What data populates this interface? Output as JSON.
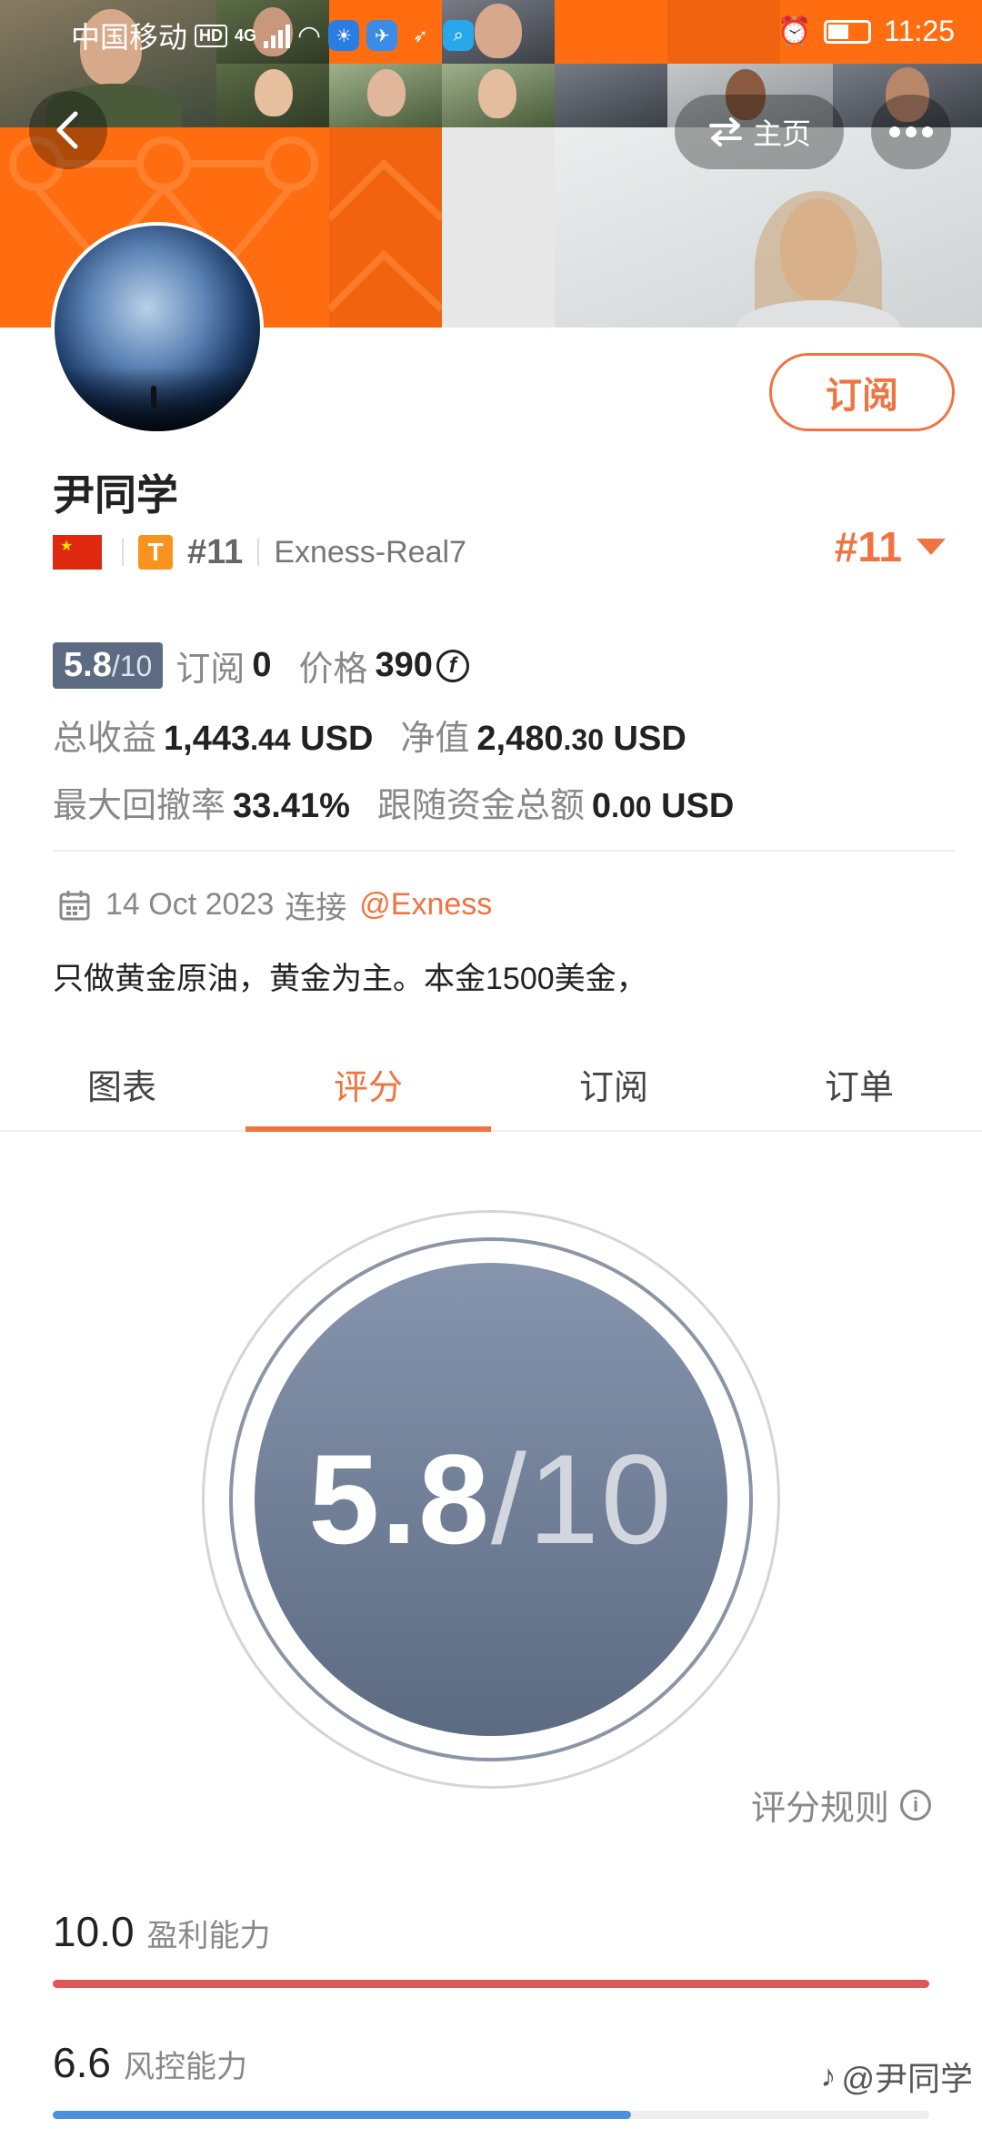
{
  "status_bar": {
    "carrier": "中国移动",
    "hd": "HD",
    "network": "4G",
    "time": "11:25"
  },
  "nav": {
    "home_label": "主页"
  },
  "profile": {
    "name": "尹同学",
    "badge_letter": "T",
    "rank_small": "#11",
    "server": "Exness-Real7",
    "rank_right": "#11",
    "subscribe_label": "订阅"
  },
  "stats": {
    "score": "5.8",
    "score_denominator": "/10",
    "subscribers_label": "订阅",
    "subscribers_value": "0",
    "price_label": "价格",
    "price_value": "390",
    "price_currency_symbol": "f",
    "total_profit_label": "总收益",
    "total_profit_main": "1,443",
    "total_profit_decimal": ".44",
    "total_profit_unit": "USD",
    "equity_label": "净值",
    "equity_main": "2,480",
    "equity_decimal": ".30",
    "equity_unit": "USD",
    "max_drawdown_label": "最大回撤率",
    "max_drawdown_value": "33.41%",
    "follow_funds_label": "跟随资金总额",
    "follow_funds_main": "0",
    "follow_funds_decimal": ".00",
    "follow_funds_unit": "USD"
  },
  "connection": {
    "date": "14 Oct 2023",
    "connect_label": "连接",
    "broker": "@Exness"
  },
  "description": "只做黄金原油，黄金为主。本金1500美金，",
  "tabs": [
    {
      "label": "图表",
      "active": false
    },
    {
      "label": "评分",
      "active": true
    },
    {
      "label": "订阅",
      "active": false
    },
    {
      "label": "订单",
      "active": false
    }
  ],
  "rating": {
    "score": "5.8",
    "max": "/10",
    "rules_label": "评分规则"
  },
  "metrics": [
    {
      "value": "10.0",
      "label": "盈利能力",
      "fraction": 1.0,
      "color": "#e05555"
    },
    {
      "value": "6.6",
      "label": "风控能力",
      "fraction": 0.66,
      "color": "#4a8fe0"
    }
  ],
  "watermark": "@尹同学",
  "colors": {
    "accent": "#f07441",
    "score_bg": "#5d6b82",
    "banner_orange": "#ff6d10"
  }
}
